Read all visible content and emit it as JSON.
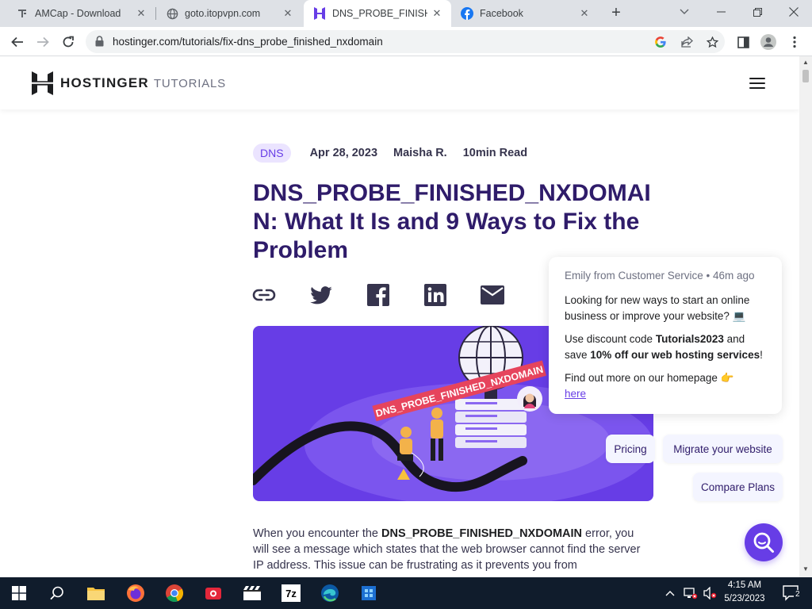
{
  "browser": {
    "tabs": [
      {
        "title": "AMCap - Download",
        "active": false
      },
      {
        "title": "goto.itopvpn.com",
        "active": false
      },
      {
        "title": "DNS_PROBE_FINISHED_",
        "active": true
      },
      {
        "title": "Facebook",
        "active": false
      }
    ],
    "url": "hostinger.com/tutorials/fix-dns_probe_finished_nxdomain"
  },
  "site": {
    "brand": "HOSTINGER",
    "brand_sub": "TUTORIALS"
  },
  "article": {
    "tag": "DNS",
    "date": "Apr 28, 2023",
    "author": "Maisha R.",
    "read_time": "10min Read",
    "title": "DNS_PROBE_FINISHED_NXDOMAIN: What It Is and 9 Ways to Fix the Problem",
    "body_prefix": "When you encounter the ",
    "body_bold": "DNS_PROBE_FINISHED_NXDOMAIN",
    "body_suffix": " error, you will see a message which states that the web browser cannot find the server IP address. This issue can be frustrating as it prevents you from"
  },
  "hero": {
    "banner_text": "DNS_PROBE_FINISHED_NXDOMAIN"
  },
  "chat": {
    "from": "Emily from Customer Service • 46m ago",
    "msg1": "Looking for new ways to start an online business or improve your website? 💻",
    "msg2_a": "Use discount code ",
    "msg2_code": "Tutorials2023",
    "msg2_b": " and save ",
    "msg2_bold": "10% off our web hosting services",
    "msg2_c": "!",
    "msg3": "Find out more on our homepage 👉",
    "link": "here",
    "chips": [
      "Pricing",
      "Migrate your website",
      "Compare Plans"
    ]
  },
  "taskbar": {
    "time": "4:15 AM",
    "date": "5/23/2023",
    "notification_count": "2"
  },
  "colors": {
    "accent": "#673de6",
    "title": "#2f1c6a",
    "tag_bg": "#ebe4ff"
  }
}
